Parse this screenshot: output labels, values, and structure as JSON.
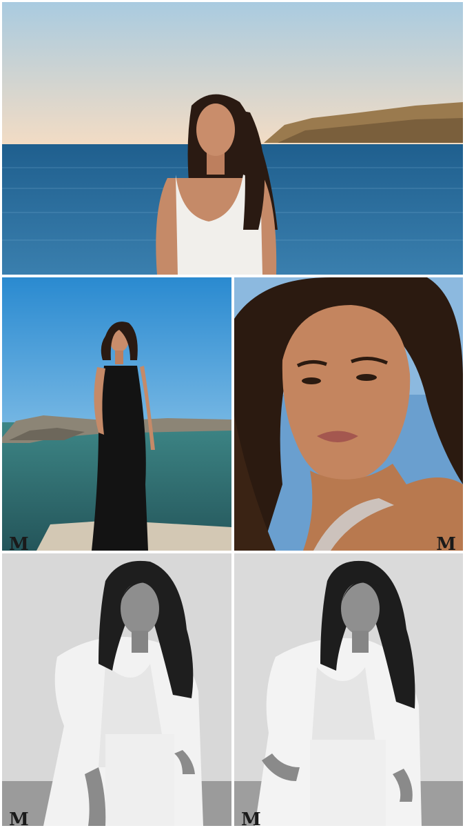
{
  "watermark": {
    "letter": "M"
  },
  "photos": [
    {
      "id": "photo-1",
      "description_shown": false
    },
    {
      "id": "photo-2"
    },
    {
      "id": "photo-3"
    },
    {
      "id": "photo-4"
    },
    {
      "id": "photo-5"
    }
  ],
  "colors": {
    "sky_top": "#a9cbe0",
    "sky_horizon": "#f3dcc4",
    "sea": "#2f6d99",
    "sky_blue": "#2f8fd0",
    "sea_green": "#2f6f6b",
    "skin": "#c58a68",
    "hair": "#2a1a12",
    "bw_bg": "#d6d6d6"
  }
}
